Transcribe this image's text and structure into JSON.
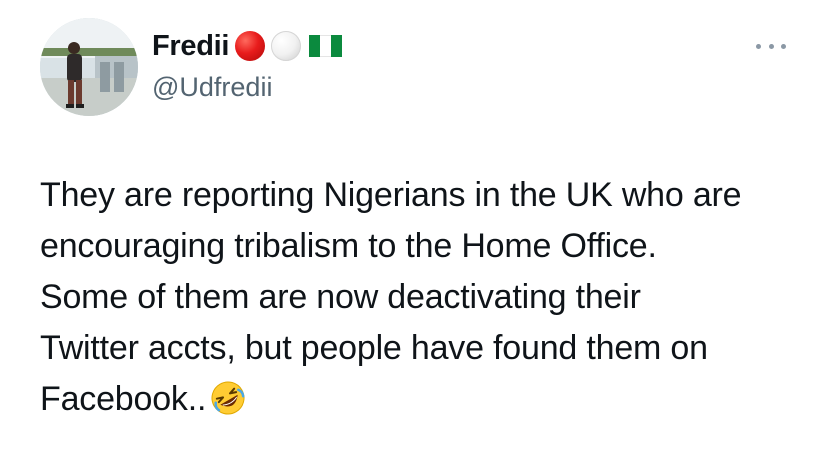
{
  "author": {
    "name": "Fredii",
    "handle": "@Udfredii",
    "name_emojis": [
      "red-circle",
      "white-circle",
      "nigeria-flag"
    ]
  },
  "tweet": {
    "lines": [
      "They are reporting Nigerians in the UK who are",
      "encouraging tribalism to the Home Office.",
      "Some of them are now deactivating their",
      "Twitter accts, but people have found them on",
      "Facebook.."
    ],
    "trailing_emoji": "rolling-on-the-floor-laughing-icon"
  },
  "colors": {
    "text": "#0f1419",
    "secondary_text": "#536471",
    "more_icon": "#8b98a5",
    "flag_green": "#0b8a3e"
  }
}
